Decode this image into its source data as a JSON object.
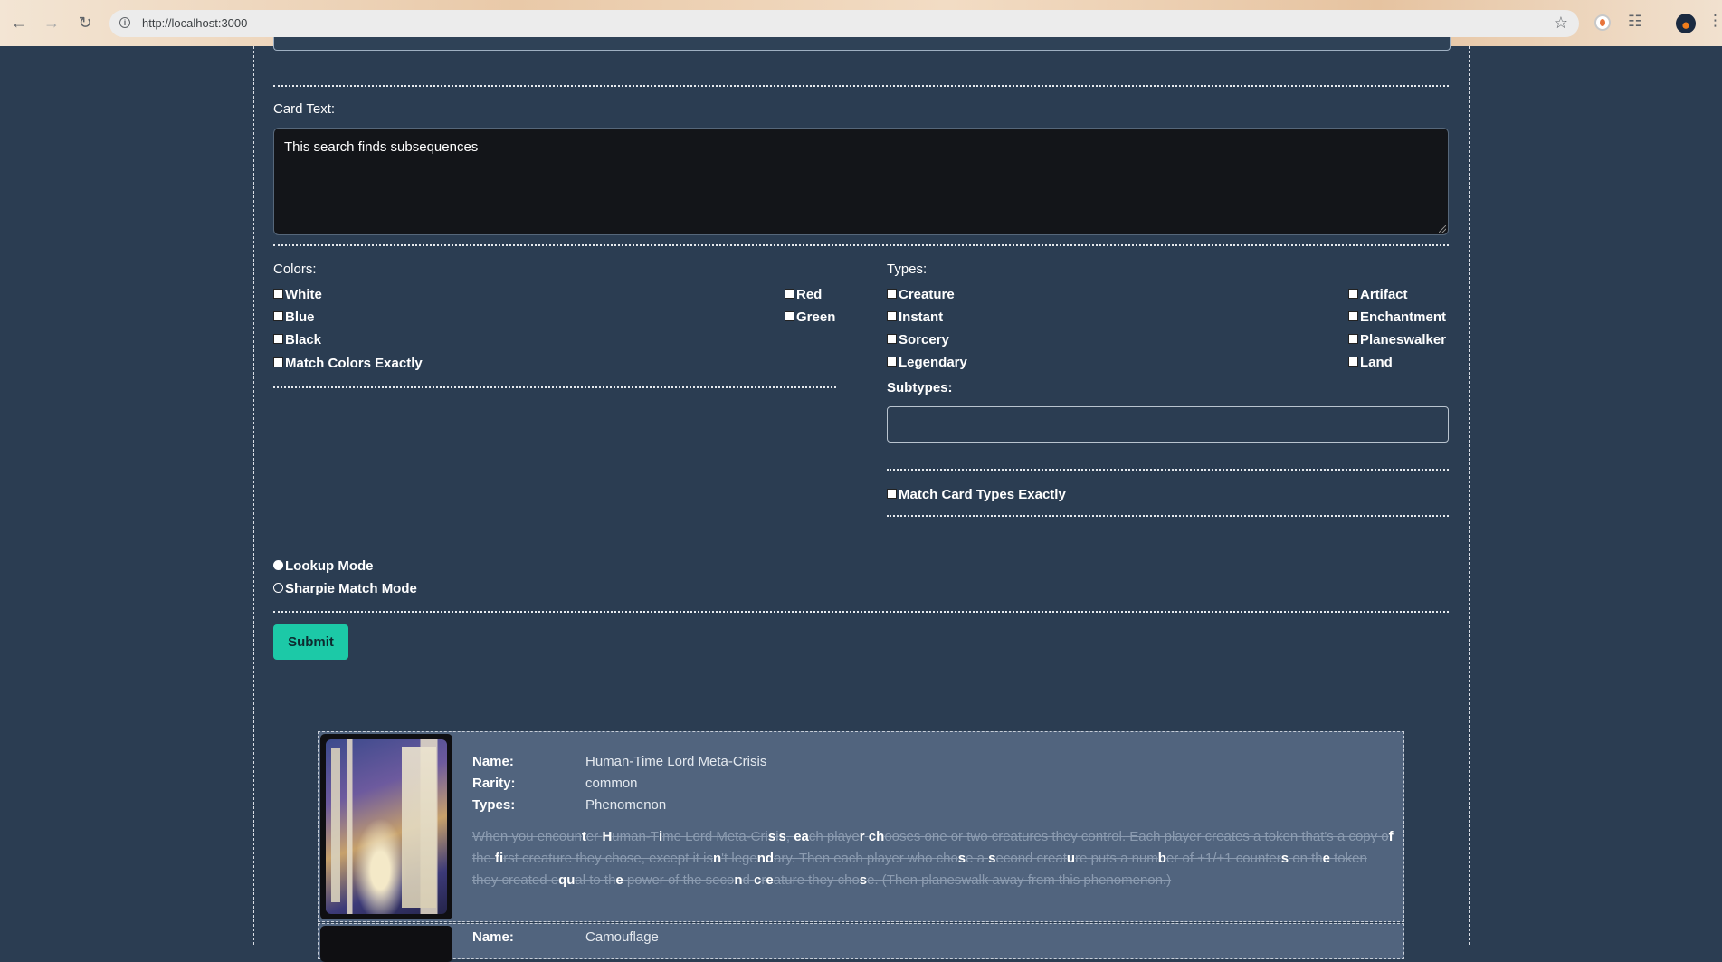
{
  "browser": {
    "url": "http://localhost:3000"
  },
  "form": {
    "card_text_label": "Card Text:",
    "card_text_value": "This search finds subsequences",
    "colors_label": "Colors:",
    "colors_left": [
      "White",
      "Blue",
      "Black"
    ],
    "colors_right": [
      "Red",
      "Green"
    ],
    "match_colors_exactly": "Match Colors Exactly",
    "types_label": "Types:",
    "types_left": [
      "Creature",
      "Instant",
      "Sorcery",
      "Legendary"
    ],
    "types_right": [
      "Artifact",
      "Enchantment",
      "Planeswalker",
      "Land"
    ],
    "subtypes_label": "Subtypes:",
    "subtypes_value": "",
    "match_types_exactly": "Match Card Types Exactly",
    "modes": [
      {
        "label": "Lookup Mode",
        "selected": true
      },
      {
        "label": "Sharpie Match Mode",
        "selected": false
      }
    ],
    "submit_label": "Submit"
  },
  "results": [
    {
      "name_label": "Name:",
      "name": "Human-Time Lord Meta-Crisis",
      "rarity_label": "Rarity:",
      "rarity": "common",
      "types_label": "Types:",
      "types": "Phenomenon",
      "oracle_segments": [
        [
          "When you encoun",
          false
        ],
        [
          "t",
          true
        ],
        [
          "er ",
          false
        ],
        [
          "H",
          true
        ],
        [
          "uman-T",
          false
        ],
        [
          "i",
          true
        ],
        [
          "me Lord Meta-Cri",
          false
        ],
        [
          "s",
          true
        ],
        [
          "i",
          false
        ],
        [
          "s",
          true
        ],
        [
          ", ",
          false
        ],
        [
          "ea",
          true
        ],
        [
          "ch playe",
          false
        ],
        [
          "r",
          true
        ],
        [
          " ",
          false
        ],
        [
          "ch",
          true
        ],
        [
          "ooses one or two creatures they control. Each player creates a token that's a copy o",
          false
        ],
        [
          "f",
          true
        ],
        [
          " the ",
          false
        ],
        [
          "f",
          true
        ],
        [
          "i",
          true
        ],
        [
          "rst creature they chose, except it is",
          false
        ],
        [
          "n",
          true
        ],
        [
          "'t lege",
          false
        ],
        [
          "n",
          true
        ],
        [
          "d",
          true
        ],
        [
          "ary. Then each player who cho",
          false
        ],
        [
          "s",
          true
        ],
        [
          "e a ",
          false
        ],
        [
          "s",
          true
        ],
        [
          "econd creat",
          false
        ],
        [
          "u",
          true
        ],
        [
          "re puts a num",
          false
        ],
        [
          "b",
          true
        ],
        [
          "er of +1/+1 counter",
          false
        ],
        [
          "s",
          true
        ],
        [
          " on th",
          false
        ],
        [
          "e",
          true
        ],
        [
          " token they created e",
          false
        ],
        [
          "qu",
          true
        ],
        [
          "al to th",
          false
        ],
        [
          "e",
          true
        ],
        [
          " power of the seco",
          false
        ],
        [
          "n",
          true
        ],
        [
          "d ",
          false
        ],
        [
          "c",
          true
        ],
        [
          "r",
          false
        ],
        [
          "e",
          true
        ],
        [
          "ature they cho",
          false
        ],
        [
          "s",
          true
        ],
        [
          "e. (Then planeswalk away from this phenomenon.)",
          false
        ]
      ]
    },
    {
      "name_label": "Name:",
      "name": "Camouflage"
    }
  ]
}
